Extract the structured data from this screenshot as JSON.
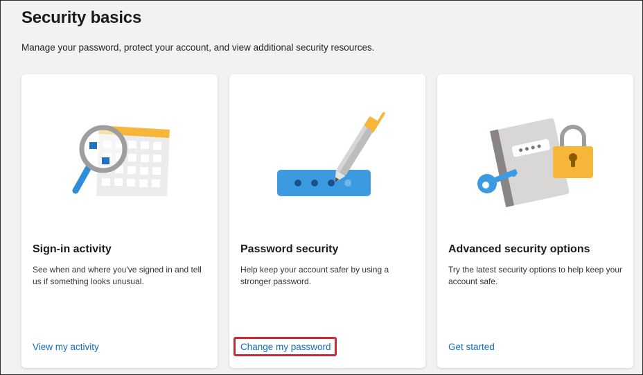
{
  "header": {
    "title": "Security basics",
    "subtitle": "Manage your password, protect your account, and view additional security resources."
  },
  "cards": [
    {
      "title": "Sign-in activity",
      "description": "See when and where you've signed in and tell us if something looks unusual.",
      "link": "View my activity",
      "illustration": "magnifier-calendar-icon"
    },
    {
      "title": "Password security",
      "description": "Help keep your account safer by using a stronger password.",
      "link": "Change my password",
      "illustration": "password-pen-icon"
    },
    {
      "title": "Advanced security options",
      "description": "Try the latest security options to help keep your account safe.",
      "link": "Get started",
      "illustration": "notebook-lock-key-icon"
    }
  ],
  "colors": {
    "accent_link": "#0f6cbd",
    "highlight": "#c72b33",
    "illustration_blue": "#2e8fd6",
    "illustration_yellow": "#f5b63a"
  }
}
